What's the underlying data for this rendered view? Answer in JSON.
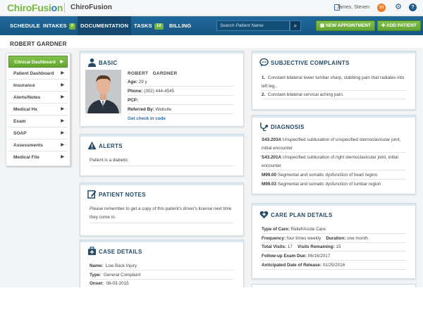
{
  "brand": {
    "logo_part1": "ChiroFusi",
    "logo_part2": "o",
    "logo_part3": "n",
    "app_name": "ChiroFusion"
  },
  "topbar": {
    "user_name": "James, Steven",
    "notification_count": "10",
    "help_label": "?"
  },
  "nav": {
    "schedule": "SCHEDULE",
    "intakes": "INTAKES",
    "intakes_count": "0",
    "documentation": "DOCUMENTATION",
    "tasks": "TASKS",
    "tasks_count": "10",
    "billing": "BILLING",
    "search_placeholder": "Search Patient Name",
    "new_appointment": "NEW APPOINTMENT",
    "add_patient": "ADD PATIENT"
  },
  "patient": {
    "header_name": "ROBERT GARDNER"
  },
  "sidebar": {
    "items": [
      {
        "label": "Clinical Dashboard"
      },
      {
        "label": "Patient Dashboard"
      },
      {
        "label": "Insurance"
      },
      {
        "label": "Alerts/Notes"
      },
      {
        "label": "Medical Hx"
      },
      {
        "label": "Exam"
      },
      {
        "label": "SOAP"
      },
      {
        "label": "Assessments"
      },
      {
        "label": "Medical File"
      }
    ]
  },
  "basic": {
    "title": "BASIC",
    "first": "ROBERT",
    "last": "GARDNER",
    "age_label": "Age:",
    "age_value": "29 y",
    "phone_label": "Phone:",
    "phone_value": "(302) 444-4545",
    "pcp_label": "PCP:",
    "pcp_value": "",
    "referred_label": "Referred By:",
    "referred_value": "Website",
    "checkin_link": "Get check in code"
  },
  "alerts": {
    "title": "ALERTS",
    "text": "Patient is a diabetic"
  },
  "notes": {
    "title": "PATIENT NOTES",
    "line1": "Please remember to get a copy of this patient's driver's license next time",
    "line2": "they come in."
  },
  "case": {
    "title": "CASE DETAILS",
    "name_label": "Name:",
    "name_value": "Low Back Injury",
    "type_label": "Type:",
    "type_value": "General Complaint",
    "onset_label": "Onset:",
    "onset_value": "08-03-2015"
  },
  "subjective": {
    "title": "SUBJECTIVE COMPLAINTS",
    "items": [
      {
        "num": "1.",
        "line1": "Constant bilateral lower lumbar sharp, stabbing pain that radiates into",
        "line2": "left leg.."
      },
      {
        "num": "2.",
        "line1": "Constant bilateral cervical aching pain.",
        "line2": ""
      }
    ]
  },
  "diagnosis": {
    "title": "DIAGNOSIS",
    "items": [
      {
        "code": "S43.203A",
        "line1": "Unspecified subluxation of unspecified sternoclavicular joint,",
        "line2": "initial encounter"
      },
      {
        "code": "S43.201A",
        "line1": "Unspecified subluxation of right sternoclavicular joint, initial",
        "line2": "encounter"
      },
      {
        "code": "M99.00",
        "line1": "Segmental and somatic dysfunction of head region",
        "line2": ""
      },
      {
        "code": "M99.03",
        "line1": "Segmental and somatic dysfunction of lumbar region",
        "line2": ""
      }
    ]
  },
  "careplan": {
    "title": "CARE PLAN DETAILS",
    "type_label": "Type of Care:",
    "type_value": "Relief/Acute Care",
    "freq_label": "Frequency:",
    "freq_value": "four times weekly",
    "dur_label": "Duration:",
    "dur_value": "one month",
    "visits_label": "Total Visits:",
    "visits_value": "17",
    "remaining_label": "Visits Remaining:",
    "remaining_value": "15",
    "followup_label": "Follow-up Exam Due:",
    "followup_value": "06/16/2017",
    "release_label": "Anticipated Date of Release:",
    "release_value": "01/25/2016"
  },
  "colors": {
    "nav_blue": "#1f6a9c",
    "accent_green": "#72b33f",
    "title_blue": "#244a66",
    "notif_orange": "#f07b22"
  }
}
